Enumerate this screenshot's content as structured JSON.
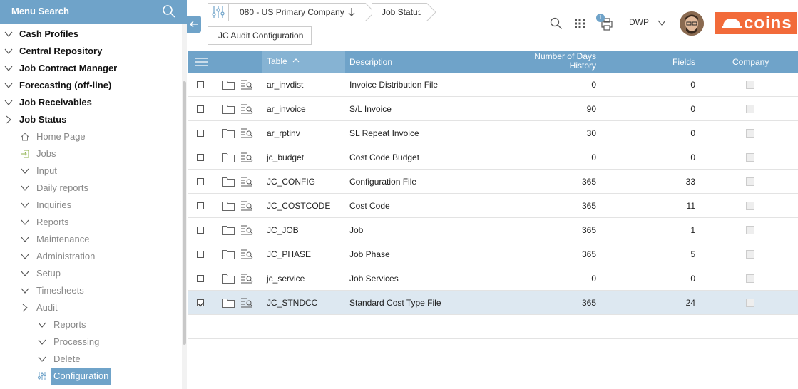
{
  "sidebar": {
    "search_label": "Menu Search",
    "items": [
      {
        "label": "Cash Profiles",
        "level": 0,
        "chev": "down"
      },
      {
        "label": "Central Repository",
        "level": 0,
        "chev": "down"
      },
      {
        "label": "Job Contract Manager",
        "level": 0,
        "chev": "down"
      },
      {
        "label": "Forecasting (off-line)",
        "level": 0,
        "chev": "down"
      },
      {
        "label": "Job Receivables",
        "level": 0,
        "chev": "down"
      },
      {
        "label": "Job Status",
        "level": 0,
        "chev": "right"
      },
      {
        "label": "Home Page",
        "level": 1,
        "chev": "home"
      },
      {
        "label": "Jobs",
        "level": 1,
        "chev": "enter"
      },
      {
        "label": "Input",
        "level": 1,
        "chev": "down"
      },
      {
        "label": "Daily reports",
        "level": 1,
        "chev": "down"
      },
      {
        "label": "Inquiries",
        "level": 1,
        "chev": "down"
      },
      {
        "label": "Reports",
        "level": 1,
        "chev": "down"
      },
      {
        "label": "Maintenance",
        "level": 1,
        "chev": "down"
      },
      {
        "label": "Administration",
        "level": 1,
        "chev": "down"
      },
      {
        "label": "Setup",
        "level": 1,
        "chev": "down"
      },
      {
        "label": "Timesheets",
        "level": 1,
        "chev": "down"
      },
      {
        "label": "Audit",
        "level": 1,
        "chev": "right"
      },
      {
        "label": "Reports",
        "level": 2,
        "chev": "down"
      },
      {
        "label": "Processing",
        "level": 2,
        "chev": "down"
      },
      {
        "label": "Delete",
        "level": 2,
        "chev": "down"
      },
      {
        "label": "Configuration",
        "level": 2,
        "chev": "sliders",
        "active": true
      }
    ]
  },
  "header": {
    "company": "080 - US Primary Company",
    "crumb2": "Job Status",
    "page_title": "JC Audit Configuration",
    "user": "DWP",
    "notification_count": "1",
    "brand": "coins",
    "accent": "#6fa3c9",
    "brand_color": "#f26b3a"
  },
  "table": {
    "columns": {
      "table": "Table",
      "description": "Description",
      "days_line1": "Number of Days",
      "days_line2": "History",
      "fields": "Fields",
      "company": "Company"
    },
    "rows": [
      {
        "table": "ar_invdist",
        "description": "Invoice Distribution File",
        "days": "0",
        "fields": "0",
        "checked": false
      },
      {
        "table": "ar_invoice",
        "description": "S/L Invoice",
        "days": "90",
        "fields": "0",
        "checked": false
      },
      {
        "table": "ar_rptinv",
        "description": "SL Repeat Invoice",
        "days": "30",
        "fields": "0",
        "checked": false
      },
      {
        "table": "jc_budget",
        "description": "Cost Code Budget",
        "days": "0",
        "fields": "0",
        "checked": false
      },
      {
        "table": "JC_CONFIG",
        "description": "Configuration File",
        "days": "365",
        "fields": "33",
        "checked": false
      },
      {
        "table": "JC_COSTCODE",
        "description": "Cost Code",
        "days": "365",
        "fields": "11",
        "checked": false
      },
      {
        "table": "JC_JOB",
        "description": "Job",
        "days": "365",
        "fields": "1",
        "checked": false
      },
      {
        "table": "JC_PHASE",
        "description": "Job Phase",
        "days": "365",
        "fields": "5",
        "checked": false
      },
      {
        "table": "jc_service",
        "description": "Job Services",
        "days": "0",
        "fields": "0",
        "checked": false
      },
      {
        "table": "JC_STNDCC",
        "description": "Standard Cost Type File",
        "days": "365",
        "fields": "24",
        "checked": true
      }
    ]
  }
}
